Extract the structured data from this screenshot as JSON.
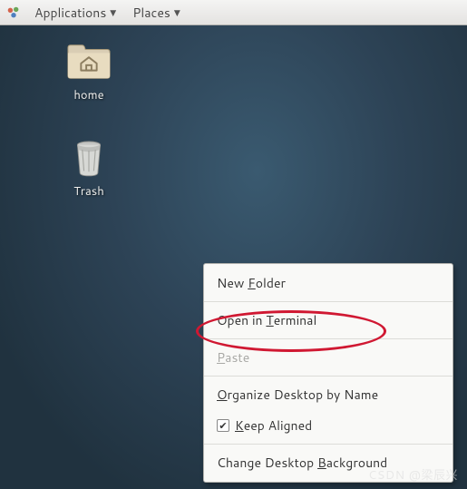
{
  "panel": {
    "applications_label": "Applications",
    "places_label": "Places"
  },
  "desktop_icons": {
    "home_label": "home",
    "trash_label": "Trash"
  },
  "context_menu": {
    "new_folder": {
      "pre": "New ",
      "m": "F",
      "post": "older"
    },
    "open_terminal": {
      "pre": "Open in ",
      "m": "T",
      "post": "erminal"
    },
    "paste": {
      "pre": "",
      "m": "P",
      "post": "aste"
    },
    "organize": {
      "pre": "",
      "m": "O",
      "post": "rganize Desktop by Name"
    },
    "keep_aligned": {
      "pre": "",
      "m": "K",
      "post": "eep Aligned",
      "checked": true
    },
    "change_bg": {
      "pre": "Change Desktop ",
      "m": "B",
      "post": "ackground"
    }
  },
  "watermark": "CSDN @梁辰兴"
}
